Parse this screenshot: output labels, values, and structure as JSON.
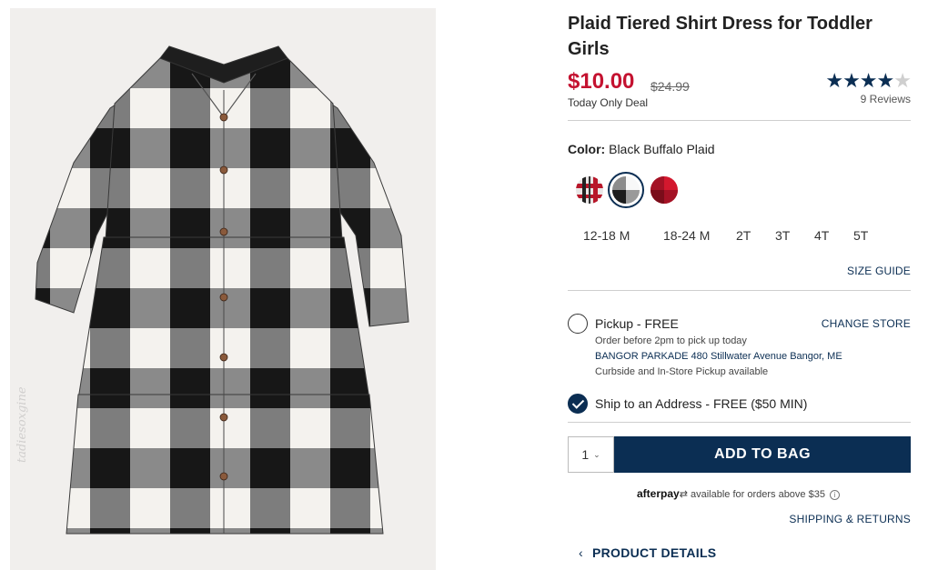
{
  "product": {
    "title": "Plaid Tiered Shirt Dress for Toddler Girls",
    "sale_price": "$10.00",
    "original_price": "$24.99",
    "deal_note": "Today Only Deal",
    "rating": 4,
    "rating_max": 5,
    "reviews": "9 Reviews",
    "watermark": "tadiesoxgine"
  },
  "color": {
    "label": "Color:",
    "selected": "Black Buffalo Plaid",
    "swatches": [
      {
        "name": "red-tartan",
        "colors": [
          "#e9e6e6",
          "#b8172a",
          "#222222"
        ]
      },
      {
        "name": "black-buffalo-plaid",
        "colors": [
          "#ffffff",
          "#1d1d1d",
          "#8c8c8c"
        ]
      },
      {
        "name": "red-buffalo-plaid",
        "colors": [
          "#d3182e",
          "#7a0d1a",
          "#a41225"
        ]
      }
    ]
  },
  "sizes": [
    "12-18 M",
    "18-24 M",
    "2T",
    "3T",
    "4T",
    "5T"
  ],
  "size_guide": "SIZE GUIDE",
  "fulfillment": {
    "pickup_label": "Pickup - FREE",
    "change_store": "CHANGE STORE",
    "pickup_note": "Order before 2pm to pick up today",
    "store": "BANGOR PARKADE 480 Stillwater Avenue  Bangor, ME",
    "pickup_options": "Curbside and In-Store Pickup available",
    "ship_label": "Ship to an Address - FREE ($50 MIN)"
  },
  "cart": {
    "quantity": "1",
    "add_to_bag": "ADD TO BAG"
  },
  "afterpay": {
    "brand": "afterpay",
    "text": "available for orders above $35"
  },
  "links": {
    "shipping_returns": "SHIPPING & RETURNS",
    "product_details": "PRODUCT DETAILS"
  },
  "colors": {
    "accent": "#0b2e53",
    "sale": "#c41230"
  },
  "icons": {
    "star": "star-icon",
    "chevron_down": "chevron-down-icon",
    "chevron_left": "chevron-left-icon",
    "info": "info-icon",
    "check": "check-icon"
  }
}
